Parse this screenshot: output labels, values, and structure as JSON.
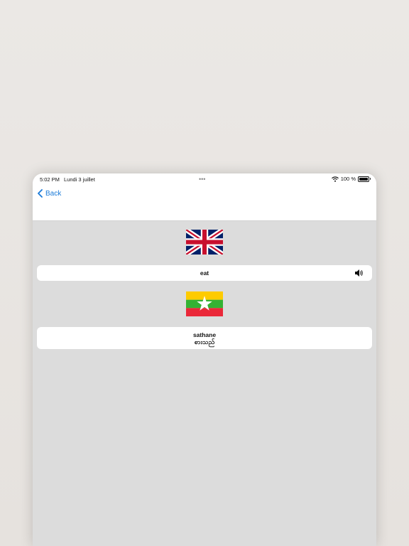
{
  "status_bar": {
    "time": "5:02 PM",
    "date": "Lundi 3 juillet",
    "dots": "•••",
    "battery_percent": "100 %",
    "icons": [
      "wifi-icon",
      "battery-icon"
    ]
  },
  "nav": {
    "back_label": "Back",
    "back_icon": "chevron-left-icon"
  },
  "source": {
    "flag": "united-kingdom-flag",
    "word": "eat",
    "audio_icon": "speaker-icon"
  },
  "target": {
    "flag": "myanmar-flag",
    "transliteration": "sathane",
    "native": "စားသည်"
  },
  "colors": {
    "accent": "#1a7ad8",
    "content_bg": "#dcdcdc",
    "card_bg": "#ffffff"
  }
}
